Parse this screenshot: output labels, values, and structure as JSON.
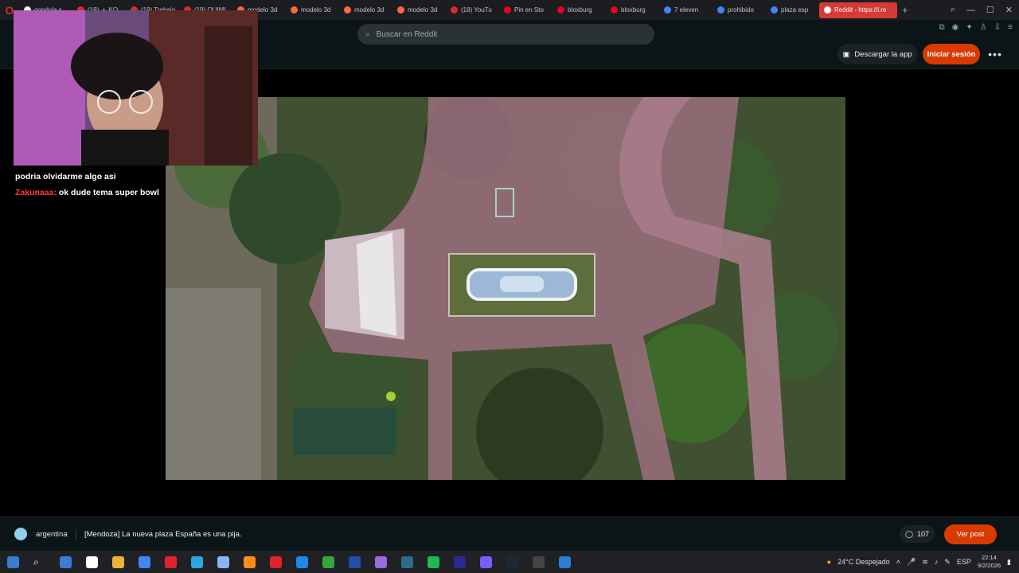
{
  "browser": {
    "tabs": [
      {
        "label": "gondola s...",
        "color": "#ffffff"
      },
      {
        "label": "(19) ▲ KO",
        "color": "#e02a2a"
      },
      {
        "label": "(19) Trabajo",
        "color": "#e02a2a"
      },
      {
        "label": "(19) QUIMI",
        "color": "#e02a2a"
      },
      {
        "label": "modelo 3d",
        "color": "#ff6a3d"
      },
      {
        "label": "modelo 3d",
        "color": "#ff6a3d"
      },
      {
        "label": "modelo 3d",
        "color": "#ff6a3d"
      },
      {
        "label": "modelo 3d",
        "color": "#ff6a3d"
      },
      {
        "label": "(18) YouTu",
        "color": "#e02a2a"
      },
      {
        "label": "Pin en Sto",
        "color": "#e60023"
      },
      {
        "label": "bloxburg",
        "color": "#e60023"
      },
      {
        "label": "bloxburg",
        "color": "#e60023"
      },
      {
        "label": "7 eleven",
        "color": "#4285f4"
      },
      {
        "label": "prohibido",
        "color": "#4285f4"
      },
      {
        "label": "plaza esp",
        "color": "#4285f4"
      }
    ],
    "active_tab": "Reddit - https://i.re",
    "new_tab": "+"
  },
  "header": {
    "search_placeholder": "Buscar en Reddit",
    "app_button": "Descargar la app",
    "login_button": "Iniciar sesión",
    "more": "•••"
  },
  "stream_chat": [
    {
      "user": "",
      "text": "podria olvidarme algo asi"
    },
    {
      "user": "Zakunaaa:",
      "text": "ok dude tema super bowl"
    }
  ],
  "post": {
    "subreddit": "argentina",
    "title": "[Mendoza] La nueva plaza España es una pija.",
    "comment_count": "107",
    "view_post": "Ver post"
  },
  "taskbar": {
    "weather": "24°C  Despejado",
    "language": "ESP",
    "time": "22:14",
    "date": "9/2/2026",
    "apps": [
      "#3a7bd5",
      "#ffffff",
      "#e8b33a",
      "#4285f4",
      "#e0242b",
      "#2aa7e0",
      "#8ab4f8",
      "#ff8c1a",
      "#e0242b",
      "#1e88e5",
      "#31a83a",
      "#1f4fa8",
      "#9c6bdc",
      "#2e6b8a",
      "#1db954",
      "#2b2a8f",
      "#7a5cff",
      "#1b2838",
      "#444444",
      "#2d7dd2"
    ]
  }
}
